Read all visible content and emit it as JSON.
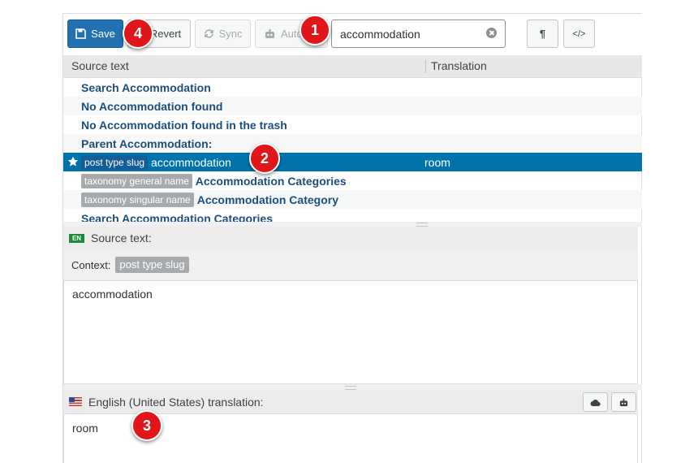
{
  "toolbar": {
    "save_label": "Save",
    "revert_label": "Revert",
    "sync_label": "Sync",
    "auto_label": "Auto",
    "search_value": "accommodation",
    "pilcrow_label": "¶",
    "code_label": "</>"
  },
  "table": {
    "header_source": "Source text",
    "header_translation": "Translation",
    "rows": [
      {
        "tag": "",
        "source": "Search Accommodation",
        "translation": ""
      },
      {
        "tag": "",
        "source": "No Accommodation found",
        "translation": ""
      },
      {
        "tag": "",
        "source": "No Accommodation found in the trash",
        "translation": ""
      },
      {
        "tag": "",
        "source": "Parent Accommodation:",
        "translation": ""
      },
      {
        "tag": "post type slug",
        "source": "accommodation",
        "translation": "room",
        "selected": true
      },
      {
        "tag": "taxonomy general name",
        "source": "Accommodation Categories",
        "translation": ""
      },
      {
        "tag": "taxonomy singular name",
        "source": "Accommodation Category",
        "translation": ""
      },
      {
        "tag": "",
        "source": "Search Accommodation Categories",
        "translation": ""
      }
    ]
  },
  "source_panel": {
    "lang_badge": "EN",
    "title": "Source text:",
    "context_label": "Context:",
    "context_tag": "post type slug",
    "text": "accommodation"
  },
  "translation_panel": {
    "title": "English (United States) translation:",
    "text": "room"
  },
  "callouts": [
    "1",
    "2",
    "3",
    "4"
  ],
  "colors": {
    "primary": "#2271b1",
    "selected_row": "#0073aa",
    "callout": "#e0161b"
  }
}
